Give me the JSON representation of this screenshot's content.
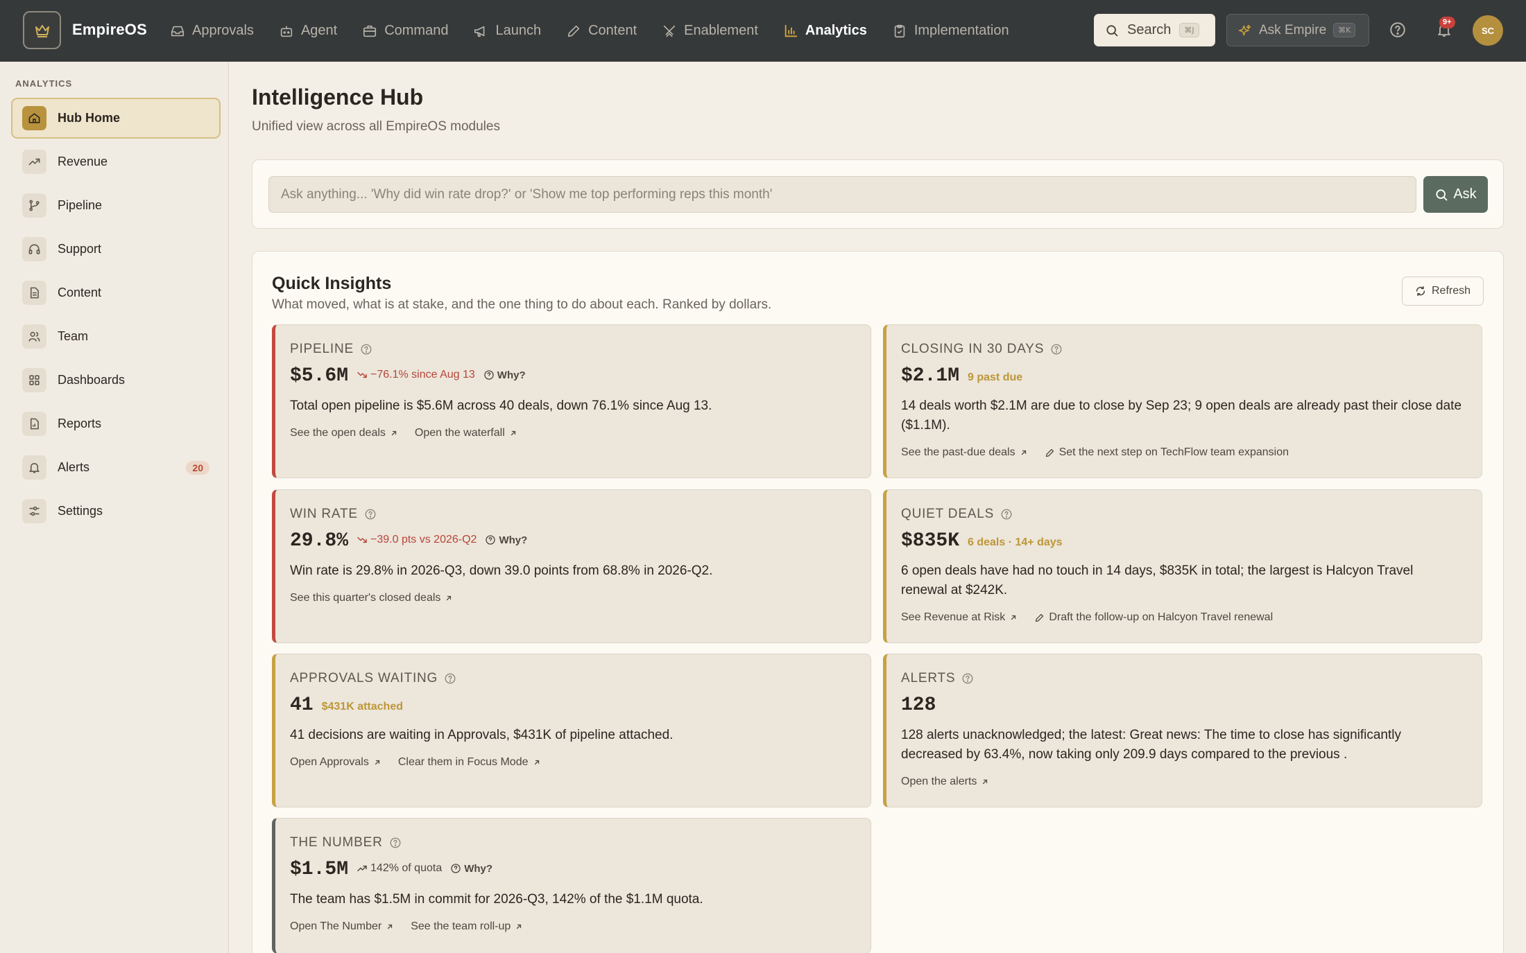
{
  "app": {
    "name": "EmpireOS"
  },
  "nav": [
    {
      "label": "Approvals",
      "icon": "inbox-icon",
      "active": false
    },
    {
      "label": "Agent",
      "icon": "bot-icon",
      "active": false
    },
    {
      "label": "Command",
      "icon": "briefcase-icon",
      "active": false
    },
    {
      "label": "Launch",
      "icon": "megaphone-icon",
      "active": false
    },
    {
      "label": "Content",
      "icon": "pen-icon",
      "active": false
    },
    {
      "label": "Enablement",
      "icon": "swords-icon",
      "active": false
    },
    {
      "label": "Analytics",
      "icon": "bar-chart-icon",
      "active": true
    },
    {
      "label": "Implementation",
      "icon": "clipboard-check-icon",
      "active": false
    }
  ],
  "topbar": {
    "search_label": "Search",
    "search_shortcut": "⌘J",
    "ask_label": "Ask Empire",
    "ask_shortcut": "⌘K",
    "notifications_badge": "9+",
    "avatar_initials": "SC"
  },
  "sidebar": {
    "heading": "ANALYTICS",
    "items": [
      {
        "label": "Hub Home",
        "icon": "home-icon",
        "active": true
      },
      {
        "label": "Revenue",
        "icon": "trend-up-icon"
      },
      {
        "label": "Pipeline",
        "icon": "git-branch-icon"
      },
      {
        "label": "Support",
        "icon": "headphones-icon"
      },
      {
        "label": "Content",
        "icon": "file-text-icon"
      },
      {
        "label": "Team",
        "icon": "users-icon"
      },
      {
        "label": "Dashboards",
        "icon": "grid-icon"
      },
      {
        "label": "Reports",
        "icon": "report-icon"
      },
      {
        "label": "Alerts",
        "icon": "bell-icon",
        "badge": "20"
      },
      {
        "label": "Settings",
        "icon": "sliders-icon"
      }
    ]
  },
  "main": {
    "title": "Intelligence Hub",
    "subtitle": "Unified view across all EmpireOS modules",
    "ask_placeholder": "Ask anything... 'Why did win rate drop?' or 'Show me top performing reps this month'",
    "ask_button": "Ask"
  },
  "insights": {
    "title": "Quick Insights",
    "subtitle": "What moved, what is at stake, and the one thing to do about each. Ranked by dollars.",
    "refresh_label": "Refresh",
    "why_label": "Why?",
    "cards": {
      "pipeline": {
        "label": "PIPELINE",
        "metric": "$5.6M",
        "delta": "−76.1% since Aug 13",
        "body": "Total open pipeline is $5.6M across 40 deals, down 76.1% since Aug 13.",
        "actions": [
          "See the open deals",
          "Open the waterfall"
        ]
      },
      "closing": {
        "label": "CLOSING IN 30 DAYS",
        "metric": "$2.1M",
        "delta": "9 past due",
        "body": "14 deals worth $2.1M are due to close by Sep 23; 9 open deals are already past their close date ($1.1M).",
        "actions": [
          "See the past-due deals",
          "Set the next step on TechFlow team expansion"
        ]
      },
      "winrate": {
        "label": "WIN RATE",
        "metric": "29.8%",
        "delta": "−39.0 pts vs 2026-Q2",
        "body": "Win rate is 29.8% in 2026-Q3, down 39.0 points from 68.8% in 2026-Q2.",
        "actions": [
          "See this quarter's closed deals"
        ]
      },
      "quiet": {
        "label": "QUIET DEALS",
        "metric": "$835K",
        "delta": "6 deals · 14+ days",
        "body": "6 open deals have had no touch in 14 days, $835K in total; the largest is Halcyon Travel renewal at $242K.",
        "actions": [
          "See Revenue at Risk",
          "Draft the follow-up on Halcyon Travel renewal"
        ]
      },
      "approvals": {
        "label": "APPROVALS WAITING",
        "metric": "41",
        "delta": "$431K attached",
        "body": "41 decisions are waiting in Approvals, $431K of pipeline attached.",
        "actions": [
          "Open Approvals",
          "Clear them in Focus Mode"
        ]
      },
      "alerts": {
        "label": "ALERTS",
        "metric": "128",
        "body": "128 alerts unacknowledged; the latest: Great news: The time to close has significantly decreased by 63.4%, now taking only 209.9 days compared to the previous .",
        "actions": [
          "Open the alerts"
        ]
      },
      "number": {
        "label": "THE NUMBER",
        "metric": "$1.5M",
        "delta": "142% of quota",
        "body": "The team has $1.5M in commit for 2026-Q3, 142% of the $1.1M quota.",
        "actions": [
          "Open The Number",
          "See the team roll-up"
        ]
      }
    }
  },
  "colors": {
    "topbar": "#36393a",
    "accent_gold": "#b8923d",
    "negative": "#c24a3e",
    "ask_button": "#5b6b5f"
  }
}
